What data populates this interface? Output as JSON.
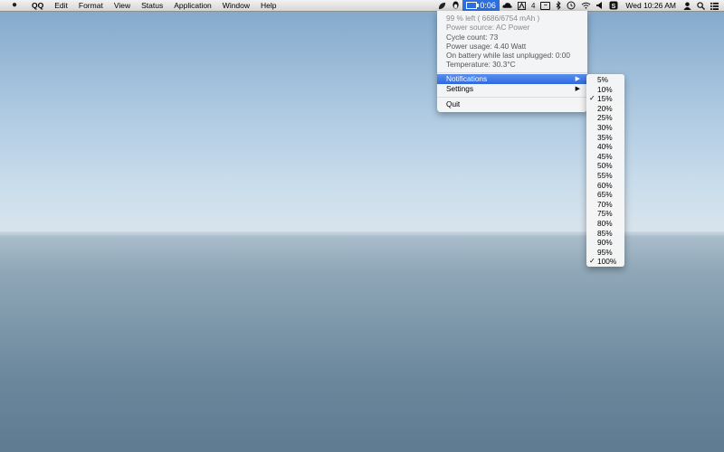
{
  "menubar": {
    "apple_symbol": "",
    "app_name": "QQ",
    "menus": [
      "Edit",
      "Format",
      "View",
      "Status",
      "Application",
      "Window",
      "Help"
    ],
    "battery_time": "0:06",
    "badge_count": "4",
    "clock": "Wed 10:26 AM",
    "icons": [
      "leaf-icon",
      "qq-penguin-icon",
      "battery-icon",
      "cloud-icon",
      "adobe-icon",
      "box-icon",
      "bluetooth-icon",
      "time-machine-icon",
      "wifi-icon",
      "volume-icon",
      "skype-icon",
      "user-icon",
      "search-icon",
      "list-icon"
    ]
  },
  "battery_menu": {
    "info": [
      "99 % left ( 6686/6754 mAh )",
      "Power source: AC Power",
      "Cycle count: 73",
      "Power usage: 4.40 Watt",
      "On battery while last unplugged: 0:00",
      "Temperature: 30.3°C"
    ],
    "items": [
      {
        "label": "Notifications",
        "highlighted": true,
        "submenu": true
      },
      {
        "label": "Settings",
        "highlighted": false,
        "submenu": true
      },
      {
        "label": "Quit",
        "highlighted": false,
        "submenu": false
      }
    ],
    "arrow_symbol": "▶"
  },
  "notifications_submenu": {
    "check_symbol": "✓",
    "items": [
      {
        "label": "5%",
        "checked": false
      },
      {
        "label": "10%",
        "checked": false
      },
      {
        "label": "15%",
        "checked": true
      },
      {
        "label": "20%",
        "checked": false
      },
      {
        "label": "25%",
        "checked": false
      },
      {
        "label": "30%",
        "checked": false
      },
      {
        "label": "35%",
        "checked": false
      },
      {
        "label": "40%",
        "checked": false
      },
      {
        "label": "45%",
        "checked": false
      },
      {
        "label": "50%",
        "checked": false
      },
      {
        "label": "55%",
        "checked": false
      },
      {
        "label": "60%",
        "checked": false
      },
      {
        "label": "65%",
        "checked": false
      },
      {
        "label": "70%",
        "checked": false
      },
      {
        "label": "75%",
        "checked": false
      },
      {
        "label": "80%",
        "checked": false
      },
      {
        "label": "85%",
        "checked": false
      },
      {
        "label": "90%",
        "checked": false
      },
      {
        "label": "95%",
        "checked": false
      },
      {
        "label": "100%",
        "checked": true
      }
    ]
  },
  "colors": {
    "highlight": "#2f69de",
    "battery_extra_bg": "#2d6fdc"
  }
}
